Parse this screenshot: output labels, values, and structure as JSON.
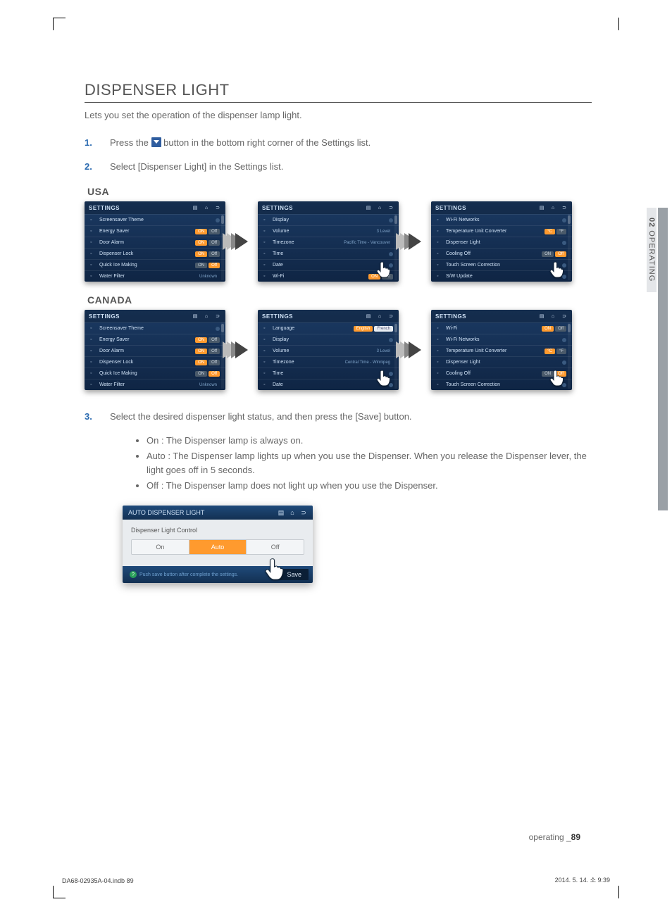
{
  "heading": "DISPENSER LIGHT",
  "intro": "Lets you set the operation of the dispenser lamp light.",
  "steps": {
    "s1_pre": "Press the ",
    "s1_post": " button in the bottom right corner of the Settings list.",
    "s2": "Select [Dispenser Light] in the Settings list.",
    "s3": "Select the desired dispenser light status, and then press the [Save] button."
  },
  "region_usa": "USA",
  "region_canada": "CANADA",
  "panel_title": "SETTINGS",
  "usa_p1": [
    {
      "label": "Screensaver Theme",
      "ctrl": "dot"
    },
    {
      "label": "Energy Saver",
      "ctrl": "onoff",
      "active": "on"
    },
    {
      "label": "Door Alarm",
      "ctrl": "onoff",
      "active": "on"
    },
    {
      "label": "Dispenser Lock",
      "ctrl": "onoff",
      "active": "on"
    },
    {
      "label": "Quick Ice Making",
      "ctrl": "onoff",
      "active": "off"
    },
    {
      "label": "Water Filter",
      "ctrl": "text",
      "text": "Unknown"
    }
  ],
  "usa_p2": [
    {
      "label": "Display",
      "ctrl": "dot"
    },
    {
      "label": "Volume",
      "ctrl": "text",
      "text": "3 Level"
    },
    {
      "label": "Timezone",
      "ctrl": "text",
      "text": "Pacific Time - Vancouver"
    },
    {
      "label": "Time",
      "ctrl": "dot"
    },
    {
      "label": "Date",
      "ctrl": "dot"
    },
    {
      "label": "Wi-Fi",
      "ctrl": "onoff",
      "active": "on"
    }
  ],
  "usa_p3": [
    {
      "label": "Wi-Fi Networks",
      "ctrl": "dot"
    },
    {
      "label": "Temperature Unit Converter",
      "ctrl": "cf",
      "active": "c"
    },
    {
      "label": "Dispenser Light",
      "ctrl": "dot"
    },
    {
      "label": "Cooling Off",
      "ctrl": "onoff",
      "active": "off"
    },
    {
      "label": "Touch Screen Correction",
      "ctrl": "dot"
    },
    {
      "label": "S/W Update",
      "ctrl": "dot"
    }
  ],
  "can_p1": [
    {
      "label": "Screensaver Theme",
      "ctrl": "dot"
    },
    {
      "label": "Energy Saver",
      "ctrl": "onoff",
      "active": "on"
    },
    {
      "label": "Door Alarm",
      "ctrl": "onoff",
      "active": "on"
    },
    {
      "label": "Dispenser Lock",
      "ctrl": "onoff",
      "active": "on"
    },
    {
      "label": "Quick Ice Making",
      "ctrl": "onoff",
      "active": "off"
    },
    {
      "label": "Water Filter",
      "ctrl": "text",
      "text": "Unknown"
    }
  ],
  "can_p2": [
    {
      "label": "Language",
      "ctrl": "lang"
    },
    {
      "label": "Display",
      "ctrl": "dot"
    },
    {
      "label": "Volume",
      "ctrl": "text",
      "text": "3 Level"
    },
    {
      "label": "Timezone",
      "ctrl": "text",
      "text": "Central Time - Winnipeg"
    },
    {
      "label": "Time",
      "ctrl": "dot"
    },
    {
      "label": "Date",
      "ctrl": "dot"
    }
  ],
  "can_p3": [
    {
      "label": "Wi-Fi",
      "ctrl": "onoff",
      "active": "on"
    },
    {
      "label": "Wi-Fi Networks",
      "ctrl": "dot"
    },
    {
      "label": "Temperature Unit Converter",
      "ctrl": "cf",
      "active": "c"
    },
    {
      "label": "Dispenser Light",
      "ctrl": "dot"
    },
    {
      "label": "Cooling Off",
      "ctrl": "onoff",
      "active": "off"
    },
    {
      "label": "Touch Screen Correction",
      "ctrl": "dot"
    }
  ],
  "bullets": [
    "On : The Dispenser lamp is always on.",
    "Auto : The Dispenser lamp lights up when you use the Dispenser. When you release the Dispenser lever, the light goes off in 5 seconds.",
    "Off : The Dispenser lamp does not light up when you use the Dispenser."
  ],
  "dl": {
    "title": "AUTO DISPENSER LIGHT",
    "sub": "Dispenser Light Control",
    "opts": [
      "On",
      "Auto",
      "Off"
    ],
    "selected": "Auto",
    "hint": "Push save button after complete the settings.",
    "save": "Save"
  },
  "sidetab": {
    "num": "02",
    "label": "  OPERATING"
  },
  "footer": {
    "section": "operating _",
    "page": "89"
  },
  "print": {
    "left": "DA68-02935A-04.indb   89",
    "right": "2014. 5. 14.   소 9:39"
  },
  "pill": {
    "on": "ON",
    "off": "Off",
    "c": "°C",
    "f": "°F",
    "en": "English",
    "fr": "French"
  }
}
